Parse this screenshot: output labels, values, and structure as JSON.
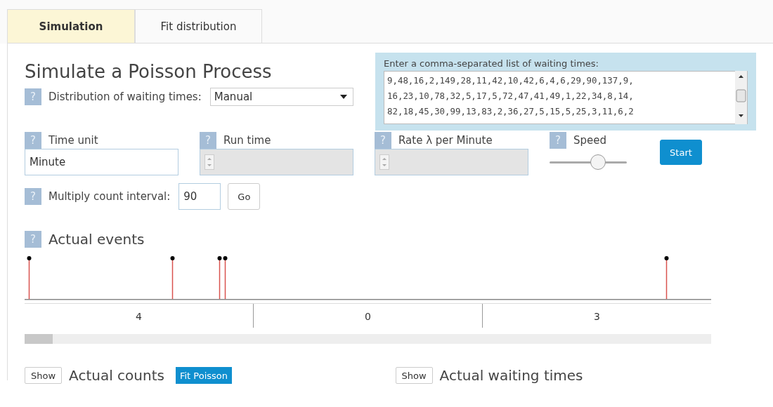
{
  "tabs": [
    {
      "label": "Simulation",
      "selected": true
    },
    {
      "label": "Fit distribution",
      "selected": false
    }
  ],
  "title": "Simulate a Poisson Process",
  "distribution": {
    "help": "?",
    "label": "Distribution of waiting times:",
    "value": "Manual"
  },
  "waiting_times": {
    "label": "Enter a comma-separated list of waiting times:",
    "lines": [
      "9,48,16,2,149,28,11,42,10,42,6,4,6,29,90,137,9,",
      "16,23,10,78,32,5,17,5,72,47,41,49,1,22,34,8,14,",
      "82,18,45,30,99,13,83,2,36,27,5,15,5,25,3,11,6,2"
    ]
  },
  "fields": [
    {
      "kind": "text",
      "help": "?",
      "label": "Time unit",
      "value": "Minute",
      "disabled": false
    },
    {
      "kind": "number",
      "help": "?",
      "label": "Run time",
      "disabled": true
    },
    {
      "kind": "number",
      "help": "?",
      "label": "Rate λ per Minute",
      "disabled": true
    },
    {
      "kind": "slider",
      "help": "?",
      "label": "Speed",
      "level": 0.64
    }
  ],
  "start_button": "Start",
  "multiply": {
    "help": "?",
    "label": "Multiply count interval:",
    "value": "90",
    "button": "Go"
  },
  "events": {
    "help": "?",
    "title": "Actual events",
    "counts": [
      "4",
      "0",
      "3"
    ]
  },
  "bottom": [
    {
      "show": "Show",
      "label": "Actual counts",
      "extra": "Fit Poisson"
    },
    {
      "show": "Show",
      "label": "Actual waiting times"
    }
  ]
}
